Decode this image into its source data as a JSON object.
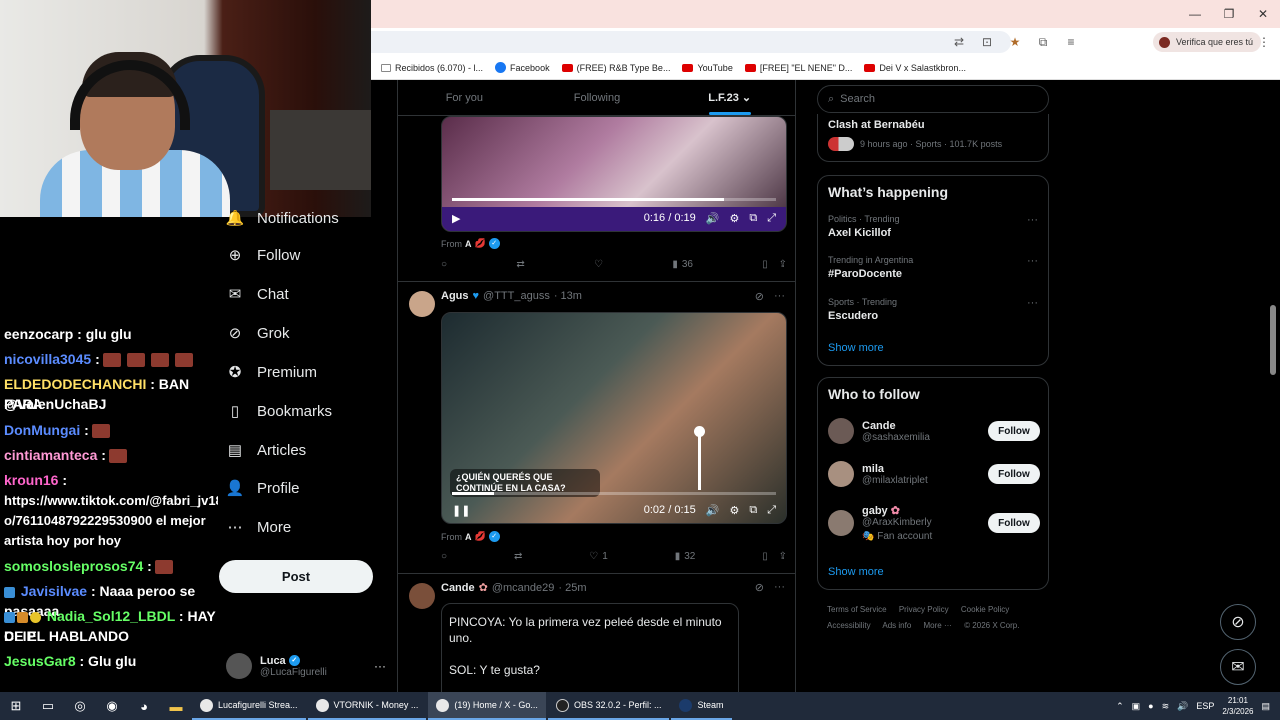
{
  "browser": {
    "window_controls": [
      "—",
      "❐",
      "✕"
    ],
    "verify_label": "Verifica que eres tú",
    "bookmarks": [
      {
        "label": "Recibidos (6.070) - l...",
        "icon": "mail-icon"
      },
      {
        "label": "Facebook",
        "icon": "facebook-icon"
      },
      {
        "label": "(FREE) R&B Type Be...",
        "icon": "youtube-icon"
      },
      {
        "label": "YouTube",
        "icon": "youtube-icon"
      },
      {
        "label": "[FREE] \"EL NENE\" D...",
        "icon": "youtube-icon"
      },
      {
        "label": "Dei V x Salastkbron...",
        "icon": "youtube-icon"
      }
    ]
  },
  "chat": {
    "lines": [
      {
        "name": "eenzocarp",
        "name_color": "#ffffff",
        "text": ": glu glu"
      },
      {
        "name": "nicovilla3045",
        "name_color": "#5b8cff",
        "text": ":"
      },
      {
        "name": "ELDEDODECHANCHI",
        "name_color": "#ffe066",
        "text": ": BAN PARA"
      },
      {
        "name": "",
        "name_color": "#ffffff",
        "text": "@ValenUchaBJ"
      },
      {
        "name": "DonMungai",
        "name_color": "#5b8cff",
        "text": ":"
      },
      {
        "name": "cintiamanteca",
        "name_color": "#ff9ad5",
        "text": ":"
      },
      {
        "name": "kroun16",
        "name_color": "#ff66cc",
        "text": ":"
      },
      {
        "name": "",
        "name_color": "#ffffff",
        "text": "https://www.tiktok.com/@fabri_jv18/vide"
      },
      {
        "name": "",
        "name_color": "#ffffff",
        "text": "o/7611048792229530900 el mejor"
      },
      {
        "name": "",
        "name_color": "#ffffff",
        "text": "artista hoy por hoy"
      },
      {
        "name": "somoslosleprosos74",
        "name_color": "#66ff66",
        "text": ":"
      },
      {
        "name": "Javisilvae",
        "name_color": "#5b8cff",
        "text": ": Naaa peroo se pasaaaa"
      },
      {
        "name": "Nadia_Sol12_LBDL",
        "name_color": "#66ff66",
        "text": ": HAY CLIP"
      },
      {
        "name": "",
        "name_color": "#ffffff",
        "text": "DE EL HABLANDO"
      },
      {
        "name": "JesusGar8",
        "name_color": "#66ff66",
        "text": ": Glu glu"
      }
    ]
  },
  "nav": {
    "items": [
      {
        "label": "Notifications",
        "icon": "bell-icon"
      },
      {
        "label": "Follow",
        "icon": "person-add-icon"
      },
      {
        "label": "Chat",
        "icon": "mail-icon"
      },
      {
        "label": "Grok",
        "icon": "grok-icon"
      },
      {
        "label": "Premium",
        "icon": "premium-icon"
      },
      {
        "label": "Bookmarks",
        "icon": "bookmark-icon"
      },
      {
        "label": "Articles",
        "icon": "article-icon"
      },
      {
        "label": "Profile",
        "icon": "person-icon"
      },
      {
        "label": "More",
        "icon": "more-icon"
      }
    ],
    "post_label": "Post",
    "account": {
      "name": "Luca",
      "handle": "@LucaFigurelli"
    }
  },
  "timeline": {
    "tabs": [
      "For you",
      "Following",
      "L.F.23"
    ],
    "video1": {
      "time": "0:16 / 0:19",
      "progress": 0.84
    },
    "tweet1": {
      "from": "From",
      "from_name": "A",
      "replies": "",
      "reposts": "",
      "likes": "",
      "views": "36"
    },
    "tweet2": {
      "name": "Agus",
      "handle": "@TTT_aguss",
      "time": "· 13m",
      "overlay": "¿QUIÉN QUERÉS QUE CONTINÚE EN LA CASA?",
      "video_time": "0:02 / 0:15",
      "progress": 0.13,
      "from": "From",
      "from_name": "A",
      "likes": "1",
      "views": "32"
    },
    "tweet3": {
      "name": "Cande",
      "handle": "@mcande29",
      "time": "· 25m",
      "text1": "PINCOYA: Yo la primera vez peleé desde el minuto uno.",
      "text2": "SOL: Y te gusta?"
    }
  },
  "sidebar": {
    "search_placeholder": "Search",
    "top_trend": {
      "name": "Clash at Bernabéu",
      "meta": "9 hours ago · Sports · 101.7K posts"
    },
    "happening_title": "What’s happening",
    "trends": [
      {
        "meta": "Politics · Trending",
        "name": "Axel Kicillof"
      },
      {
        "meta": "Trending in Argentina",
        "name": "#ParoDocente"
      },
      {
        "meta": "Sports · Trending",
        "name": "Escudero"
      }
    ],
    "show_more": "Show more",
    "wtf_title": "Who to follow",
    "follow_label": "Follow",
    "people": [
      {
        "name": "Cande",
        "handle": "@sashaxemilia",
        "extra": ""
      },
      {
        "name": "mila",
        "handle": "@milaxlatriplet",
        "extra": ""
      },
      {
        "name": "gaby",
        "handle": "@AraxKimberly",
        "extra": "Fan account"
      }
    ],
    "footer": [
      "Terms of Service",
      "Privacy Policy",
      "Cookie Policy",
      "Accessibility",
      "Ads info",
      "More ···",
      "© 2026 X Corp."
    ]
  },
  "taskbar": {
    "apps": [
      {
        "label": "Lucafigurelli Strea..."
      },
      {
        "label": "VTORNIK - Money ..."
      },
      {
        "label": "(19) Home / X - Go..."
      },
      {
        "label": "OBS 32.0.2 - Perfil: ..."
      },
      {
        "label": "Steam"
      }
    ],
    "lang": "ESP",
    "time": "21:01",
    "date": "2/3/2026"
  }
}
